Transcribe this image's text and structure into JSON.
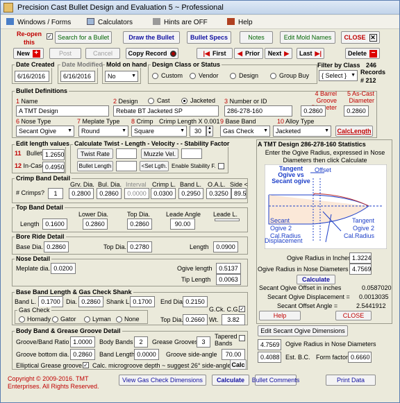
{
  "window": {
    "title": "Precision Cast Bullet Design and Evaluation 5  ~  Professional"
  },
  "menu": {
    "windows": "Windows / Forms",
    "calculators": "Calculators",
    "hints": "Hints are OFF",
    "help": "Help"
  },
  "toolbar": {
    "reopen": "Re-open this record",
    "search": "Search for a Bullet",
    "draw": "Draw the Bullet",
    "specs": "Bullet Specs",
    "notes": "Notes",
    "edit_mold": "Edit Mold Names",
    "close": "CLOSE",
    "new": "New",
    "post": "Post",
    "cancel": "Cancel",
    "copy": "Copy Record",
    "first": "First",
    "prior": "Prior",
    "next": "Next",
    "last": "Last",
    "delete": "Delete"
  },
  "dates": {
    "created_label": "Date Created",
    "created": "6/16/2016",
    "modified_label": "Date Modified",
    "modified": "6/16/2016",
    "mold_label": "Mold on hand",
    "mold": "No"
  },
  "design_class": {
    "label": "Design Class or Status",
    "options": [
      "Custom",
      "Vendor",
      "Design",
      "Group Buy"
    ]
  },
  "filter": {
    "label": "Filter by Class",
    "value": "{ Select }",
    "records_label": "Records",
    "records_count": "246",
    "record_num": "# 212"
  },
  "defs": {
    "title": "Bullet Definitions",
    "name_label": "Name",
    "name": "A TMT Design",
    "design_label": "Design",
    "cast": "Cast",
    "jacketed": "Jacketed",
    "design": "Rebate BT Jacketed SP",
    "number_label": "Number or ID",
    "number": "286-278-160",
    "bg_label": "Barrel Groove Diameter",
    "bg": "0.2860",
    "ac_label": "As-Cast Diameter",
    "ac": "0.2860",
    "nose_label": "Nose Type",
    "nose": "Secant Ogive",
    "meplate_label": "Meplate Type",
    "meplate": "Round",
    "crimp_label": "Crimp",
    "crimp": "Square",
    "crimp_len_label": "Crimp Length X 0.001",
    "crimp_len": "30",
    "base_label": "Base Band",
    "base": "Gas Check",
    "alloy_label": "Alloy Type",
    "alloy": "Jacketed",
    "calclength": "CalcLength",
    "n1": "1",
    "n2": "2",
    "n3": "3",
    "n4": "4",
    "n5": "5",
    "n6": "6",
    "n7": "7",
    "n8": "8",
    "n9": "9",
    "n10": "10",
    "n11": "11",
    "n12": "12"
  },
  "edit_len": {
    "title": "Edit length values",
    "bullet_label": "Bullet",
    "bullet": "1.2650",
    "incase_label": "In-Case",
    "incase": "0.4950"
  },
  "twist": {
    "title": "Calculate Twist - Length - Velocity - - Stability Factor",
    "twist_rate": "Twist Rate",
    "muzzle": "Muzzle Vel.",
    "bullet_length": "Bullet Length",
    "set_lgth": "<Set Lgth.",
    "enable_stab": "Enable Stability F."
  },
  "crimp_band": {
    "title": "Crimp Band Detail",
    "crimps_label": "# Crimps?",
    "crimps": "1",
    "headers": [
      "Grv. Dia.",
      "Bul. Dia.",
      "Interval",
      "Crimp L.",
      "Band L.",
      "O.A.L.",
      "Side <"
    ],
    "values": [
      "0.2800",
      "0.2860",
      "0.0000",
      "0.0300",
      "0.2950",
      "0.3250",
      "89.5"
    ]
  },
  "top_band": {
    "title": "Top Band Detail",
    "length_label": "Length",
    "length": "0.1600",
    "lower_label": "Lower Dia.",
    "lower": "0.2860",
    "top_label": "Top Dia.",
    "top": "0.2860",
    "lead_label": "Leade Angle",
    "lead": "90.00",
    "leadl_label": "Leade L."
  },
  "bore_ride": {
    "title": "Bore Ride Detail",
    "base_label": "Base Dia.",
    "base": "0.2860",
    "top_label": "Top Dia.",
    "top": "0.2780",
    "length_label": "Length",
    "length": "0.0900"
  },
  "nose": {
    "title": "Nose Detail",
    "meplate_label": "Meplate dia.",
    "meplate": "0.0200",
    "ogive_label": "Ogive length",
    "ogive": "0.5137",
    "tip_label": "Tip Length",
    "tip": "0.0063"
  },
  "base_band": {
    "title": "Base Band Length & Gas Check Shank",
    "bandl_label": "Band L.",
    "bandl": "0.1700",
    "dia_label": "Dia.",
    "dia": "0.2860",
    "shank_label": "Shank L.",
    "shank": "0.1700",
    "enddia_label": "End Dia.",
    "enddia": "0.2150",
    "gck_label": "G.Ck. C.G.",
    "gascheck_label": "Gas Check",
    "gc_options": [
      "Hornady",
      "Gator",
      "Lyman",
      "None"
    ],
    "topdia_label": "Top Dia.",
    "topdia": "0.2660",
    "wt_label": "Wt.",
    "wt": "3.82"
  },
  "grease": {
    "title": "Body Band & Grease Groove Detail",
    "ratio_label": "Groove/Band Ratio",
    "ratio": "1.0000",
    "bodybands_label": "Body Bands",
    "bodybands": "2",
    "grooves_label": "Grease Grooves",
    "grooves": "3",
    "tapered_label": "Tapered Bands",
    "bottom_label": "Groove bottom dia.",
    "bottom": "0.2860",
    "bandlen_label": "Band Length",
    "bandlen": "0.0000",
    "sideangle_label": "Groove side-angle",
    "sideangle": "70.00",
    "ellip_label": "Elliptical Grease groove",
    "calcmicro": "Calc. microgroove depth ~ suggest 26° side-angle>",
    "calc": "Calc"
  },
  "stats": {
    "title": "A TMT Design 286-278-160 Statistics",
    "instructions": "Enter the Ogive Radius, expressed in Nose Diameters then click Calculate",
    "diagram": {
      "tangent_vs_secant": "Tangent Ogive vs Secant ogive",
      "offset": "Offset",
      "secant_cal": "Secant Ogive 2 Cal.Radius",
      "tangent_cal": "Tangent Ogive 2 Cal.Radius",
      "displacement": "Displacement"
    },
    "ogive_radius_in_label": "Ogive Radius in Inches",
    "ogive_radius_in": "1.3224",
    "ogive_radius_nd_label": "Ogive Radius in Nose Diameters",
    "ogive_radius_nd": "4.7569",
    "calculate": "Calculate",
    "offset_label": "Secant Ogive Offset in inches",
    "offset": "0.0587020",
    "displacement_label": "Secant Ogive Displacement =",
    "displacement": "0.0013035",
    "angle_label": "Secant Offset Angle =",
    "angle": "2.5441912",
    "help": "Help",
    "close": "CLOSE"
  },
  "bottom_right": {
    "edit_secant": "Edit Secant Ogive Dimensions",
    "ogive_nd": "4.7569",
    "ogive_nd_label": "Ogive Radius in Nose Diameters",
    "bc": "0.4088",
    "bc_label": "Est. B.C.",
    "ff_label": "Form factor",
    "ff": "0.6660"
  },
  "footer": {
    "copyright": "Copyright © 2009-2016. TMT Enterprises. All Rights Reserved.",
    "view_gc": "View Gas Check Dimensions",
    "calculate": "Calculate",
    "comments": "Bullet Comments",
    "print": "Print Data"
  },
  "colors": {
    "accent_red": "#c00000",
    "button_blue": "#1010a0",
    "diagram_blue": "#1d3fc8"
  }
}
